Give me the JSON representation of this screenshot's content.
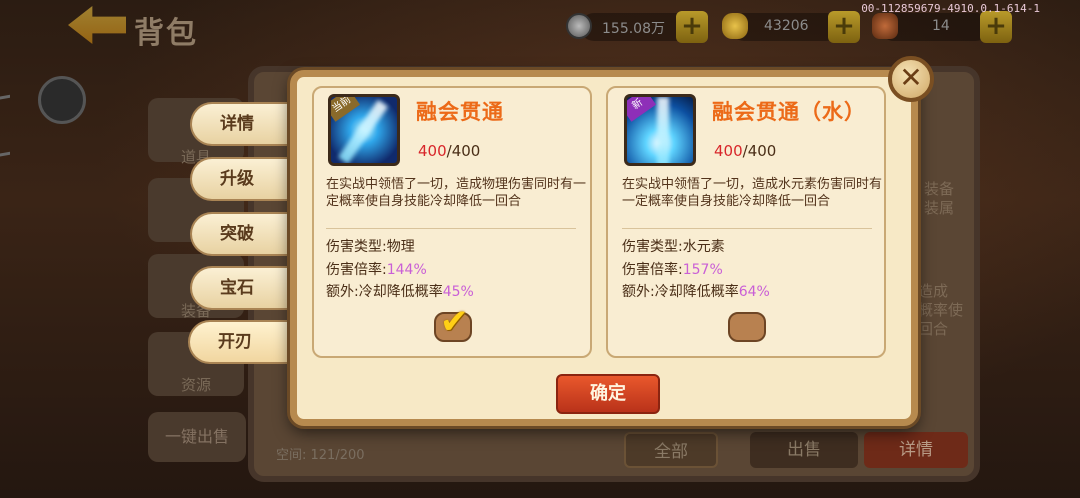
{
  "header": {
    "title": "背包",
    "silver": "155.08万",
    "gold": "43206",
    "stamina": "14",
    "build_id": "00-112859679-4910.0.1-614-1"
  },
  "background": {
    "categories": [
      "道具",
      "装备",
      "资源"
    ],
    "one_key_sell": "一键出售",
    "space": "空间: 121/200",
    "btn_all": "全部",
    "btn_sell": "出售",
    "btn_detail": "详情",
    "side_text_1": "装备\n装属",
    "side_text_2": "造成\n概率使\n回合"
  },
  "tabs": [
    {
      "label": "详情"
    },
    {
      "label": "升级"
    },
    {
      "label": "突破"
    },
    {
      "label": "宝石"
    },
    {
      "label": "开刃"
    }
  ],
  "cards": [
    {
      "badge": "当前",
      "name": "融会贯通",
      "count_current": "400",
      "count_total": "/400",
      "description": "在实战中领悟了一切，造成物理伤害同时有一定概率使自身技能冷却降低一回合",
      "damage_type_label": "伤害类型:",
      "damage_type": "物理",
      "multiplier_label": "伤害倍率:",
      "multiplier": "144%",
      "extra_label": "额外:冷却降低概率",
      "extra": "45%",
      "selected": true
    },
    {
      "badge": "新",
      "name": "融会贯通（水）",
      "count_current": "400",
      "count_total": "/400",
      "description": "在实战中领悟了一切，造成水元素伤害同时有一定概率使自身技能冷却降低一回合",
      "damage_type_label": "伤害类型:",
      "damage_type": "水元素",
      "multiplier_label": "伤害倍率:",
      "multiplier": "157%",
      "extra_label": "额外:冷却降低概率",
      "extra": "64%",
      "selected": false
    }
  ],
  "confirm": "确定",
  "close": "✕",
  "colors": {
    "skill_name": "#ec6a18",
    "count_current": "#d8262a",
    "percent": "#c95fd6",
    "confirm_button": "#d2431f"
  }
}
